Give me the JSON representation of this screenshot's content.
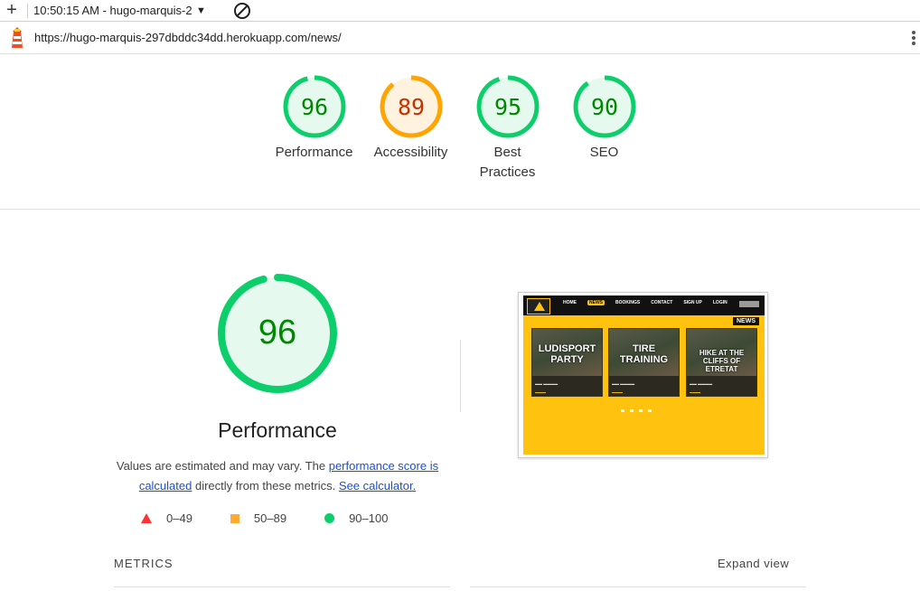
{
  "toolbar": {
    "add_icon": "plus-icon",
    "report_label": "10:50:15 AM - hugo-marquis-2",
    "dropdown_icon": "caret-down-icon",
    "clear_icon": "block-icon"
  },
  "urlbar": {
    "logo": "lighthouse-icon",
    "url": "https://hugo-marquis-297dbddc34dd.herokuapp.com/news/",
    "menu_icon": "kebab-menu-icon"
  },
  "scores": [
    {
      "value": 96,
      "label": "Performance",
      "color": "#0cce6b",
      "text_color": "#008800",
      "fill": "#e5f9ee"
    },
    {
      "value": 89,
      "label": "Accessibility",
      "color": "#ffa400",
      "text_color": "#c33300",
      "fill": "#fff3e0"
    },
    {
      "value": 95,
      "label": "Best Practices",
      "color": "#0cce6b",
      "text_color": "#008800",
      "fill": "#e5f9ee"
    },
    {
      "value": 90,
      "label": "SEO",
      "color": "#0cce6b",
      "text_color": "#008800",
      "fill": "#e5f9ee"
    }
  ],
  "performance": {
    "score": 96,
    "title": "Performance",
    "desc_prefix": "Values are estimated and may vary. The ",
    "link1": "performance score is calculated",
    "desc_middle": " directly from these metrics. ",
    "link2": "See calculator."
  },
  "legend": [
    {
      "shape": "triangle",
      "range": "0–49",
      "color": "#ff3333"
    },
    {
      "shape": "square",
      "range": "50–89",
      "color": "#ffaa33"
    },
    {
      "shape": "circle",
      "range": "90–100",
      "color": "#0cce6b"
    }
  ],
  "thumbnail": {
    "menu": [
      "HOME",
      "NEWS",
      "BOOKINGS",
      "CONTACT",
      "SIGN UP",
      "LOGIN"
    ],
    "heading": "NEWS",
    "cards": [
      {
        "title": "LUDISPORT PARTY"
      },
      {
        "title": "TIRE TRAINING"
      },
      {
        "title": "HIKE AT THE CLIFFS OF ETRETAT"
      }
    ]
  },
  "metrics": {
    "label": "METRICS",
    "expand": "Expand view"
  }
}
